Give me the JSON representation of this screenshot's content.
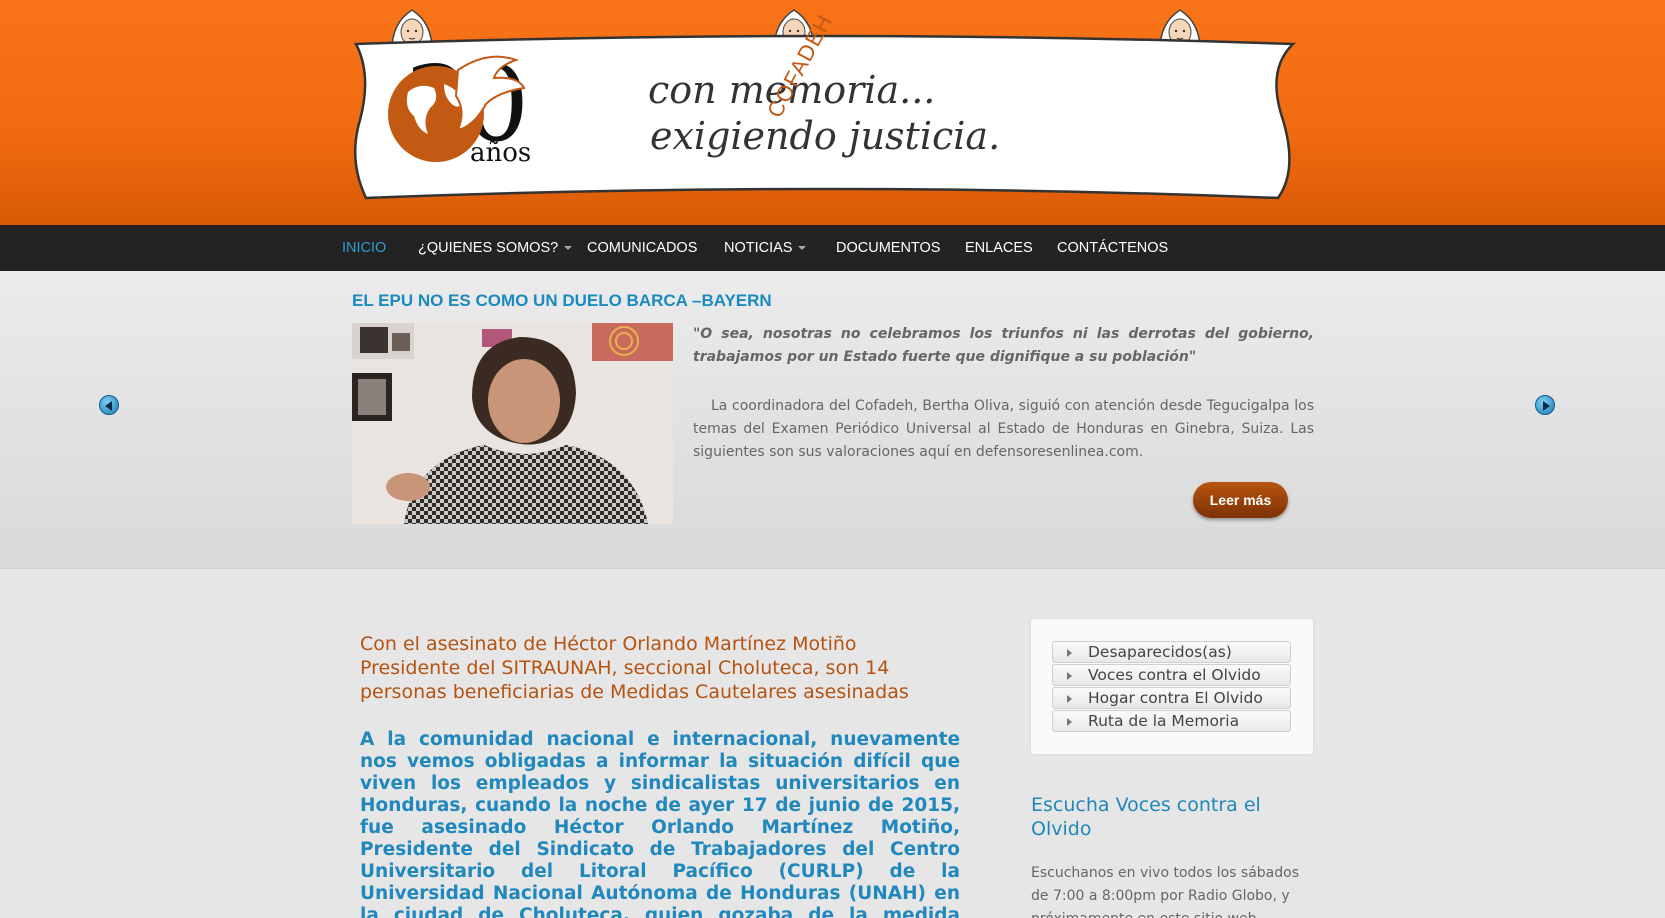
{
  "banner": {
    "number": "30",
    "years": "años",
    "slogan_line1": "con memoria...",
    "slogan_line2": "exigiendo justicia.",
    "logo_text": "COFADEH"
  },
  "nav": {
    "items": [
      {
        "label": "INICIO",
        "active": true
      },
      {
        "label": "¿QUIENES SOMOS?",
        "dropdown": true
      },
      {
        "label": "COMUNICADOS"
      },
      {
        "label": "NOTICIAS",
        "dropdown": true
      },
      {
        "label": "DOCUMENTOS"
      },
      {
        "label": "ENLACES"
      },
      {
        "label": "CONTÁCTENOS"
      }
    ]
  },
  "slider": {
    "title": "EL EPU NO ES COMO UN DUELO BARCA –BAYERN",
    "quote": "\"O sea, nosotras no celebramos los triunfos ni las derrotas del gobierno, trabajamos por un Estado fuerte que dignifique a su población\"",
    "body": "La coordinadora del Cofadeh, Bertha Oliva, siguió con atención desde Tegucigalpa los temas del Examen Periódico Universal al Estado de Honduras en Ginebra, Suiza. Las siguientes son sus valoraciones aquí en defensoresenlinea.com.",
    "button": "Leer más"
  },
  "article": {
    "title": "Con el asesinato de Héctor Orlando Martínez Motiño Presidente del SITRAUNAH, seccional Choluteca, son 14 personas beneficiarias de Medidas Cautelares asesinadas",
    "body": "A la comunidad nacional e internacional, nuevamente nos vemos obligadas a informar la situación difícil que viven los empleados y sindicalistas universitarios en Honduras, cuando la noche de ayer 17 de junio de 2015, fue asesinado Héctor Orlando Martínez Motiño, Presidente del Sindicato de Trabajadores del Centro Universitario del Litoral Pacífico (CURLP) de la Universidad Nacional Autónoma de Honduras (UNAH) en la ciudad de Choluteca, quien gozaba de la medida cautelar No."
  },
  "sidebar": {
    "menu": [
      "Desaparecidos(as)",
      "Voces contra el Olvido",
      "Hogar contra El Olvido",
      "Ruta de la Memoria"
    ],
    "section_title": "Escucha Voces contra el Olvido",
    "section_text": "Escuchanos en vivo todos los sábados de 7:00 a 8:00pm por Radio Globo, y próximamente en este sitio web."
  },
  "colors": {
    "header_orange": "#f06a10",
    "nav_bg": "#232323",
    "active_link": "#2f9ed1",
    "title_blue": "#1a8ac0",
    "article_orange": "#b55311",
    "button_brown": "#9c430a"
  }
}
